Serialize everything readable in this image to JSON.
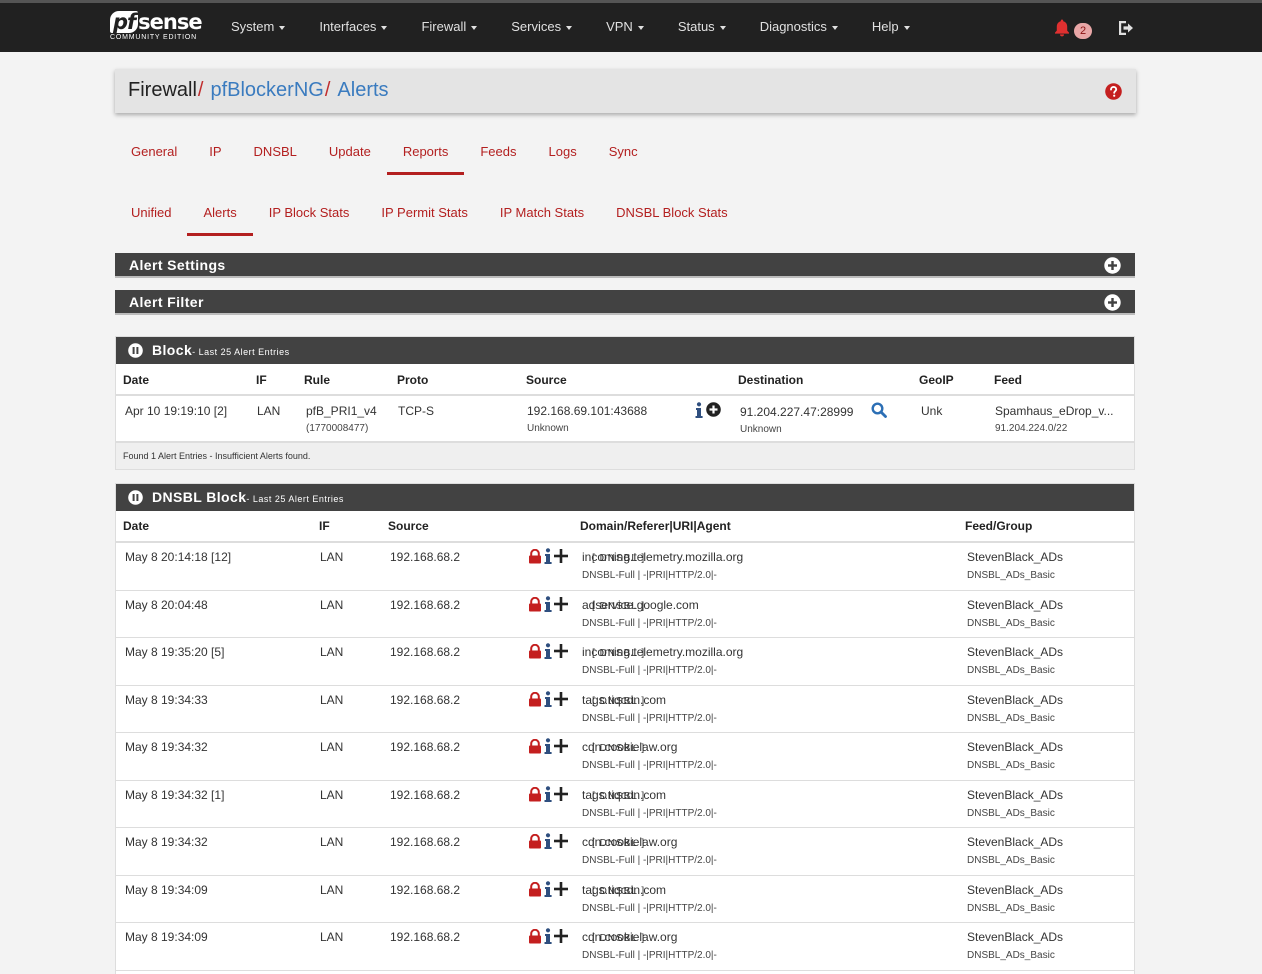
{
  "brand": {
    "name": "sense",
    "prefix": "pf",
    "edition": "COMMUNITY EDITION"
  },
  "nav": [
    "System",
    "Interfaces",
    "Firewall",
    "Services",
    "VPN",
    "Status",
    "Diagnostics",
    "Help"
  ],
  "notifications": {
    "count": "2"
  },
  "breadcrumb": {
    "root": "Firewall",
    "mid": "pfBlockerNG",
    "leaf": "Alerts",
    "sep": "/"
  },
  "tabs_main": [
    "General",
    "IP",
    "DNSBL",
    "Update",
    "Reports",
    "Feeds",
    "Logs",
    "Sync"
  ],
  "tabs_sub": [
    "Unified",
    "Alerts",
    "IP Block Stats",
    "IP Permit Stats",
    "IP Match Stats",
    "DNSBL Block Stats"
  ],
  "panels": {
    "alert_settings": "Alert Settings",
    "alert_filter": "Alert Filter"
  },
  "block": {
    "title": "Block",
    "subtitle": "- Last 25 Alert Entries",
    "headers": {
      "date": "Date",
      "if": "IF",
      "rule": "Rule",
      "proto": "Proto",
      "source": "Source",
      "destination": "Destination",
      "geoip": "GeoIP",
      "feed": "Feed"
    },
    "row": {
      "date": "Apr 10 19:19:10 [2]",
      "if": "LAN",
      "rule": "pfB_PRI1_v4",
      "rule_id": "(1770008477)",
      "proto": "TCP-S",
      "source": "192.168.69.101:43688",
      "source_host": "Unknown",
      "destination": "91.204.227.47:28999",
      "dest_host": "Unknown",
      "geoip": "Unk",
      "feed": "Spamhaus_eDrop_v...",
      "feed_net": "91.204.224.0/22"
    },
    "footer": "Found 1 Alert Entries - Insufficient Alerts found."
  },
  "dnsbl": {
    "title": "DNSBL Block",
    "subtitle": "- Last 25 Alert Entries",
    "headers": {
      "date": "Date",
      "if": "IF",
      "source": "Source",
      "domain": "Domain/Referer|URI|Agent",
      "feed": "Feed/Group"
    },
    "rows": [
      {
        "date": "May 8 20:14:18 [12]",
        "if": "LAN",
        "source": "192.168.68.2",
        "domain": "incoming.telemetry.mozilla.org",
        "tag": "[ DNSBL ]",
        "detail": "DNSBL-Full | -|PRI|HTTP/2.0|-",
        "feed": "StevenBlack_ADs",
        "group": "DNSBL_ADs_Basic"
      },
      {
        "date": "May 8 20:04:48",
        "if": "LAN",
        "source": "192.168.68.2",
        "domain": "adservice.google.com",
        "tag": "[ DNSBL ]",
        "detail": "DNSBL-Full | -|PRI|HTTP/2.0|-",
        "feed": "StevenBlack_ADs",
        "group": "DNSBL_ADs_Basic"
      },
      {
        "date": "May 8 19:35:20 [5]",
        "if": "LAN",
        "source": "192.168.68.2",
        "domain": "incoming.telemetry.mozilla.org",
        "tag": "[ DNSBL ]",
        "detail": "DNSBL-Full | -|PRI|HTTP/2.0|-",
        "feed": "StevenBlack_ADs",
        "group": "DNSBL_ADs_Basic"
      },
      {
        "date": "May 8 19:34:33",
        "if": "LAN",
        "source": "192.168.68.2",
        "domain": "tags.tiqcdn.com",
        "tag": "[ DNSBL ]",
        "detail": "DNSBL-Full | -|PRI|HTTP/2.0|-",
        "feed": "StevenBlack_ADs",
        "group": "DNSBL_ADs_Basic"
      },
      {
        "date": "May 8 19:34:32",
        "if": "LAN",
        "source": "192.168.68.2",
        "domain": "cdn.cookielaw.org",
        "tag": "[ DNSBL ]",
        "detail": "DNSBL-Full | -|PRI|HTTP/2.0|-",
        "feed": "StevenBlack_ADs",
        "group": "DNSBL_ADs_Basic"
      },
      {
        "date": "May 8 19:34:32 [1]",
        "if": "LAN",
        "source": "192.168.68.2",
        "domain": "tags.tiqcdn.com",
        "tag": "[ DNSBL ]",
        "detail": "DNSBL-Full | -|PRI|HTTP/2.0|-",
        "feed": "StevenBlack_ADs",
        "group": "DNSBL_ADs_Basic"
      },
      {
        "date": "May 8 19:34:32",
        "if": "LAN",
        "source": "192.168.68.2",
        "domain": "cdn.cookielaw.org",
        "tag": "[ DNSBL ]",
        "detail": "DNSBL-Full | -|PRI|HTTP/2.0|-",
        "feed": "StevenBlack_ADs",
        "group": "DNSBL_ADs_Basic"
      },
      {
        "date": "May 8 19:34:09",
        "if": "LAN",
        "source": "192.168.68.2",
        "domain": "tags.tiqcdn.com",
        "tag": "[ DNSBL ]",
        "detail": "DNSBL-Full | -|PRI|HTTP/2.0|-",
        "feed": "StevenBlack_ADs",
        "group": "DNSBL_ADs_Basic"
      },
      {
        "date": "May 8 19:34:09",
        "if": "LAN",
        "source": "192.168.68.2",
        "domain": "cdn.cookielaw.org",
        "tag": "[ DNSBL ]",
        "detail": "DNSBL-Full | -|PRI|HTTP/2.0|-",
        "feed": "StevenBlack_ADs",
        "group": "DNSBL_ADs_Basic"
      }
    ]
  },
  "colors": {
    "accent": "#b31f1f",
    "navbar": "#212121",
    "panel_header": "#424242",
    "link": "#3a7bbf"
  },
  "icons": [
    "bell-icon",
    "logout-icon",
    "help-icon",
    "plus-circle-icon",
    "pause-icon",
    "info-icon",
    "search-icon",
    "lock-icon",
    "plus-icon"
  ]
}
